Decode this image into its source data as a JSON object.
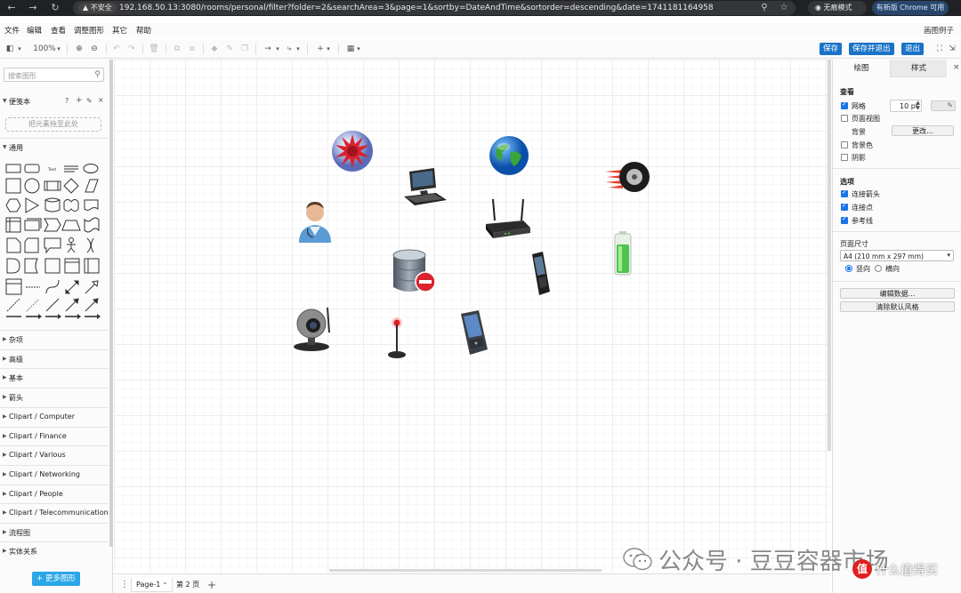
{
  "browser": {
    "security_label": "不安全",
    "url": "192.168.50.13:3080/rooms/personal/filter?folder=2&searchArea=3&page=1&sortby=DateAndTime&sortorder=descending&date=1741181164958",
    "incognito_label": "无痕模式",
    "update_label": "有新版 Chrome 可用"
  },
  "menu": {
    "items": [
      "文件",
      "编辑",
      "查看",
      "调整图形",
      "其它",
      "帮助"
    ],
    "doc_name": "画图例子"
  },
  "toolbar": {
    "zoom": "100%",
    "save_label": "保存",
    "save_exit_label": "保存并退出",
    "exit_label": "退出"
  },
  "sidebar": {
    "search_placeholder": "搜索图形",
    "scratchpad_label": "便笺本",
    "scratchpad_drop": "把元素拖至此处",
    "general_label": "通用",
    "sections": [
      "杂项",
      "高级",
      "基本",
      "箭头",
      "Clipart / Computer",
      "Clipart / Finance",
      "Clipart / Various",
      "Clipart / Networking",
      "Clipart / People",
      "Clipart / Telecommunication",
      "流程图",
      "实体关系"
    ],
    "more_shapes": "+ 更多图形"
  },
  "pages": {
    "tabs": [
      "Page-1",
      "第 2 页"
    ]
  },
  "format_panel": {
    "tab_drawing": "绘图",
    "tab_style": "样式",
    "view_title": "查看",
    "grid_label": "网格",
    "grid_size": "10 pt",
    "page_view_label": "页面视图",
    "background_label": "背景",
    "change_label": "更改...",
    "background_color_label": "背景色",
    "shadow_label": "阴影",
    "options_title": "选项",
    "connection_arrows_label": "连接箭头",
    "connection_points_label": "连接点",
    "guides_label": "参考线",
    "paper_size_title": "页面尺寸",
    "paper_size_value": "A4 (210 mm x 297 mm)",
    "portrait_label": "竖向",
    "landscape_label": "横向",
    "edit_data_label": "编辑数据...",
    "clear_style_label": "清除默认风格"
  },
  "watermark": {
    "text": "公众号 · 豆豆容器市场",
    "logo_text": "值 什么值得买"
  },
  "colors": {
    "accent_blue": "#1a73c8",
    "more_shapes_blue": "#2aa6e9",
    "browser_dark": "#1f2124"
  }
}
